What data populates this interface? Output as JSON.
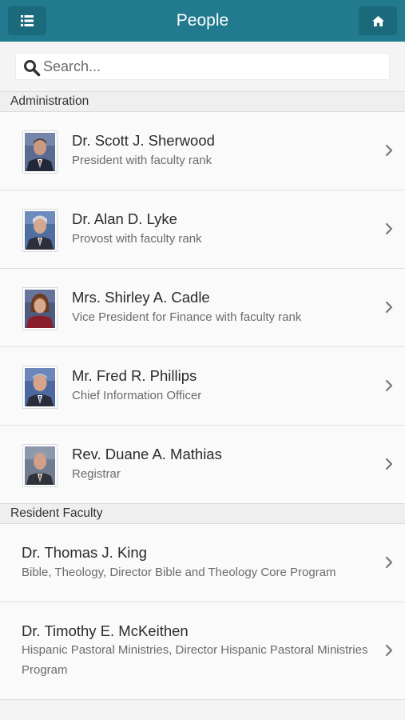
{
  "header": {
    "title": "People",
    "menu_icon": "list-icon",
    "home_icon": "home-icon",
    "color": "#217a8e"
  },
  "search": {
    "placeholder": "Search..."
  },
  "sections": [
    {
      "title": "Administration",
      "items": [
        {
          "name": "Dr. Scott J. Sherwood",
          "subtitle": "President with faculty rank",
          "has_photo": true
        },
        {
          "name": "Dr. Alan D. Lyke",
          "subtitle": "Provost with faculty rank",
          "has_photo": true
        },
        {
          "name": "Mrs. Shirley A. Cadle",
          "subtitle": "Vice President for Finance with faculty rank",
          "has_photo": true
        },
        {
          "name": "Mr. Fred R. Phillips",
          "subtitle": "Chief Information Officer",
          "has_photo": true
        },
        {
          "name": "Rev. Duane A. Mathias",
          "subtitle": "Registrar",
          "has_photo": true
        }
      ]
    },
    {
      "title": "Resident Faculty",
      "items": [
        {
          "name": "Dr. Thomas J. King",
          "subtitle": "Bible, Theology, Director Bible and Theology Core Program",
          "has_photo": false
        },
        {
          "name": "Dr. Timothy E. McKeithen",
          "subtitle": "Hispanic Pastoral Ministries, Director Hispanic Pastoral Ministries Program",
          "has_photo": false
        }
      ]
    }
  ]
}
